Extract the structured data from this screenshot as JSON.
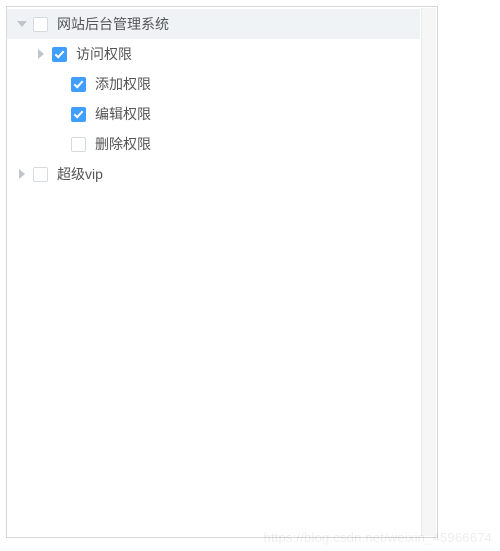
{
  "tree": [
    {
      "id": "root-backend",
      "label": "网站后台管理系统",
      "checked": false,
      "expanded": true,
      "hasChildren": true,
      "selected": true,
      "indent": 0,
      "children": [
        {
          "id": "access-perm",
          "label": "访问权限",
          "checked": true,
          "expanded": true,
          "hasChildren": true,
          "selected": false,
          "indent": 1,
          "toggleState": "collapsed",
          "children": [
            {
              "id": "add-perm",
              "label": "添加权限",
              "checked": true,
              "hasChildren": false,
              "indent": 2
            },
            {
              "id": "edit-perm",
              "label": "编辑权限",
              "checked": true,
              "hasChildren": false,
              "indent": 2
            },
            {
              "id": "delete-perm",
              "label": "删除权限",
              "checked": false,
              "hasChildren": false,
              "indent": 2
            }
          ]
        }
      ]
    },
    {
      "id": "super-vip",
      "label": "超级vip",
      "checked": false,
      "expanded": false,
      "hasChildren": true,
      "selected": false,
      "indent": 0,
      "toggleState": "collapsed"
    }
  ],
  "indentUnit": 19,
  "baseIndent": 4,
  "watermark": "https://blog.csdn.net/weixin_45966674",
  "colors": {
    "checkboxChecked": "#409eff",
    "checkboxBorder": "#d6d9de",
    "rowSelected": "#f0f3f6",
    "toggleArrow": "#c0c4cc",
    "panelBorder": "#d6d6d6"
  }
}
